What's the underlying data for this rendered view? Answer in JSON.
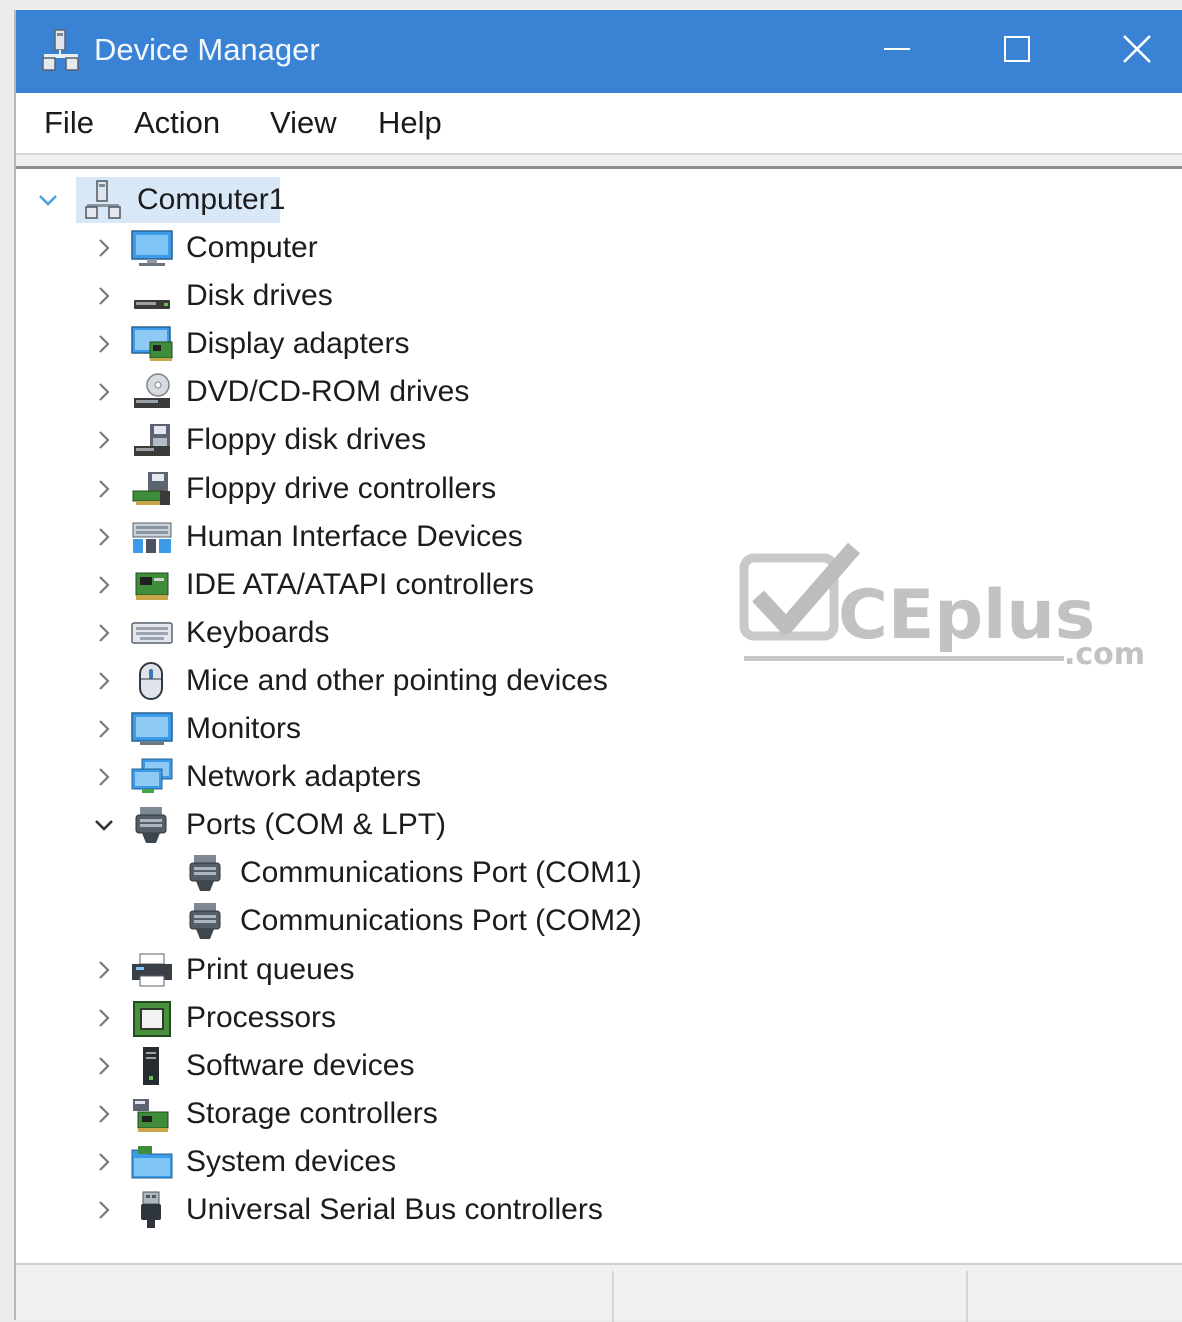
{
  "window": {
    "title": "Device Manager",
    "titlebar_color": "#3a82d4",
    "controls": {
      "minimize": "minimize-icon",
      "maximize": "maximize-icon",
      "close": "close-icon"
    }
  },
  "menu": [
    "File",
    "Action",
    "View",
    "Help"
  ],
  "tree": {
    "root": {
      "label": "Computer1",
      "icon": "computer-network-icon",
      "expanded": true,
      "selected": true
    },
    "items": [
      {
        "label": "Computer",
        "icon": "computer-icon",
        "expanded": false
      },
      {
        "label": "Disk drives",
        "icon": "disk-drive-icon",
        "expanded": false
      },
      {
        "label": "Display adapters",
        "icon": "display-adapter-icon",
        "expanded": false
      },
      {
        "label": "DVD/CD-ROM drives",
        "icon": "dvd-drive-icon",
        "expanded": false
      },
      {
        "label": "Floppy disk drives",
        "icon": "floppy-disk-icon",
        "expanded": false
      },
      {
        "label": "Floppy drive controllers",
        "icon": "floppy-controller-icon",
        "expanded": false
      },
      {
        "label": "Human Interface Devices",
        "icon": "hid-icon",
        "expanded": false
      },
      {
        "label": "IDE ATA/ATAPI controllers",
        "icon": "ide-controller-icon",
        "expanded": false
      },
      {
        "label": "Keyboards",
        "icon": "keyboard-icon",
        "expanded": false
      },
      {
        "label": "Mice and other pointing devices",
        "icon": "mouse-icon",
        "expanded": false
      },
      {
        "label": "Monitors",
        "icon": "monitor-icon",
        "expanded": false
      },
      {
        "label": "Network adapters",
        "icon": "network-adapter-icon",
        "expanded": false
      },
      {
        "label": "Ports (COM & LPT)",
        "icon": "port-icon",
        "expanded": true
      },
      {
        "label": "Communications Port (COM1)",
        "icon": "port-icon",
        "child": true
      },
      {
        "label": "Communications Port (COM2)",
        "icon": "port-icon",
        "child": true
      },
      {
        "label": "Print queues",
        "icon": "printer-icon",
        "expanded": false
      },
      {
        "label": "Processors",
        "icon": "processor-icon",
        "expanded": false
      },
      {
        "label": "Software devices",
        "icon": "software-device-icon",
        "expanded": false
      },
      {
        "label": "Storage controllers",
        "icon": "storage-controller-icon",
        "expanded": false
      },
      {
        "label": "System devices",
        "icon": "system-devices-icon",
        "expanded": false
      },
      {
        "label": "Universal Serial Bus controllers",
        "icon": "usb-icon",
        "expanded": false
      }
    ]
  },
  "watermark": {
    "brand": "CEplus",
    "suffix": ".com"
  }
}
